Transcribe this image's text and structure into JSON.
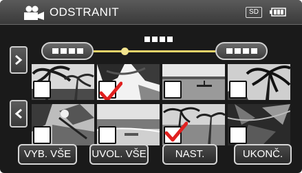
{
  "header": {
    "mode_icon": "video-camera-icon",
    "title": "ODSTRANIT",
    "media_badge": "SD",
    "battery_icon": "battery-icon"
  },
  "range_selector": {
    "left_icon": "date-placeholder-glyphs",
    "right_icon": "date-placeholder-glyphs",
    "center_icon": "date-placeholder-glyphs"
  },
  "navigation": {
    "next_icon": "chevron-right-icon",
    "prev_icon": "chevron-left-icon"
  },
  "thumbnails": [
    {
      "scene": "palm-trees-sunset",
      "checked": false
    },
    {
      "scene": "palm-leaf-closeup",
      "checked": true
    },
    {
      "scene": "boat-on-lake",
      "checked": false
    },
    {
      "scene": "palm-silhouette-sky",
      "checked": false
    },
    {
      "scene": "sunlit-foliage",
      "checked": false
    },
    {
      "scene": "beach-shoreline",
      "checked": false
    },
    {
      "scene": "palms-over-water",
      "checked": true
    },
    {
      "scene": "dark-leaves",
      "checked": false
    }
  ],
  "actions": {
    "select_all": "VYB. VŠE",
    "deselect_all": "UVOL. VŠE",
    "set": "NAST.",
    "end": "UKONČ."
  }
}
